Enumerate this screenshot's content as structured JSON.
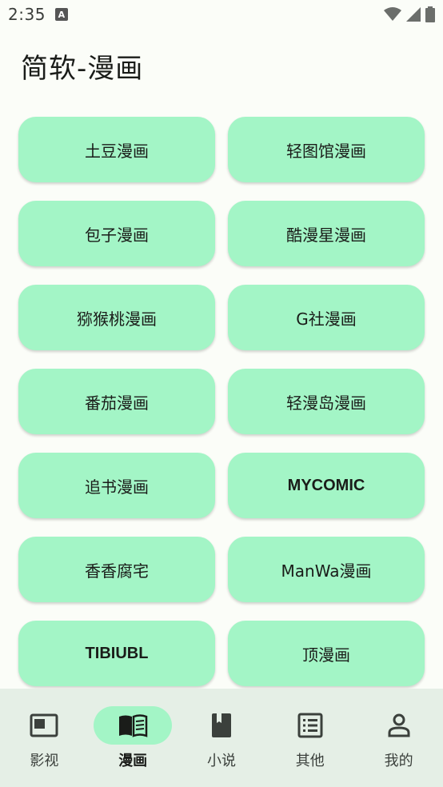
{
  "status_bar": {
    "time": "2:35",
    "notification_icon": "a-icon",
    "icons": [
      "wifi-icon",
      "signal-icon",
      "battery-icon"
    ]
  },
  "page": {
    "title": "简软-漫画"
  },
  "tiles": [
    {
      "label": "土豆漫画"
    },
    {
      "label": "轻图馆漫画"
    },
    {
      "label": "包子漫画"
    },
    {
      "label": "酷漫星漫画"
    },
    {
      "label": "猕猴桃漫画"
    },
    {
      "label": "G社漫画"
    },
    {
      "label": "番茄漫画"
    },
    {
      "label": "轻漫岛漫画"
    },
    {
      "label": "追书漫画"
    },
    {
      "label": "MYCOMIC"
    },
    {
      "label": "香香腐宅"
    },
    {
      "label": "ManWa漫画"
    },
    {
      "label": "TIBIUBL"
    },
    {
      "label": "顶漫画"
    }
  ],
  "bottom_nav": {
    "items": [
      {
        "label": "影视",
        "icon": "video-icon",
        "active": false
      },
      {
        "label": "漫画",
        "icon": "comic-book-icon",
        "active": true
      },
      {
        "label": "小说",
        "icon": "book-icon",
        "active": false
      },
      {
        "label": "其他",
        "icon": "list-icon",
        "active": false
      },
      {
        "label": "我的",
        "icon": "person-icon",
        "active": false
      }
    ]
  },
  "colors": {
    "background": "#fbfdf8",
    "tile": "#a3f5c6",
    "nav_background": "#e5efe6",
    "nav_active_pill": "#a3f5c6"
  }
}
